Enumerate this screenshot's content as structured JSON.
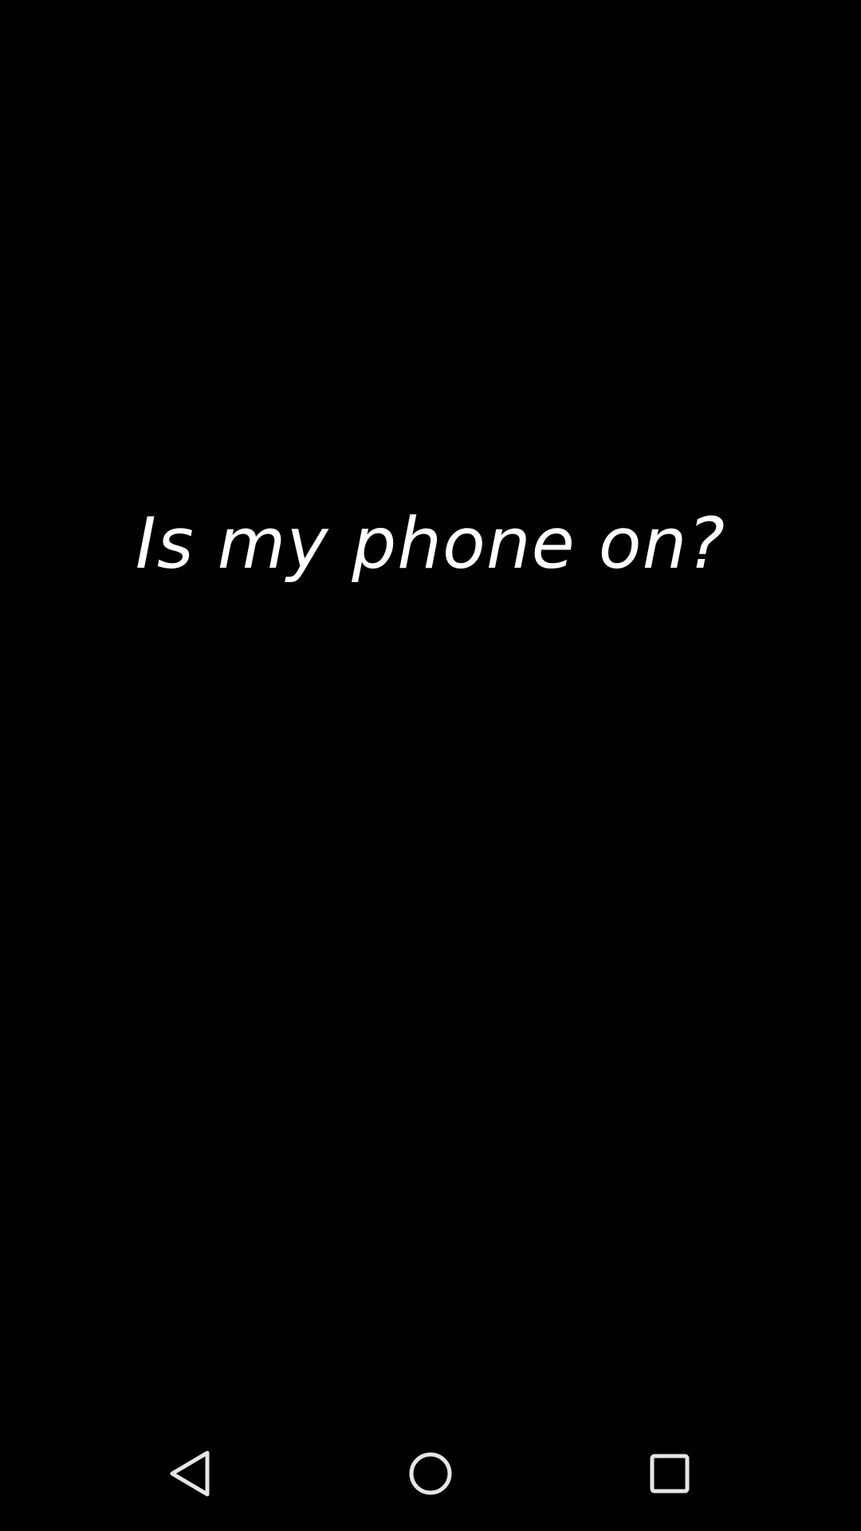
{
  "main": {
    "message": "Is my phone on?"
  },
  "navigation_bar": {
    "buttons": [
      {
        "name": "back",
        "icon": "back-triangle-icon"
      },
      {
        "name": "home",
        "icon": "home-circle-icon"
      },
      {
        "name": "recents",
        "icon": "recents-square-icon"
      }
    ]
  },
  "colors": {
    "background": "#000000",
    "text": "#ffffff",
    "nav_icon": "#e6e6e6"
  }
}
